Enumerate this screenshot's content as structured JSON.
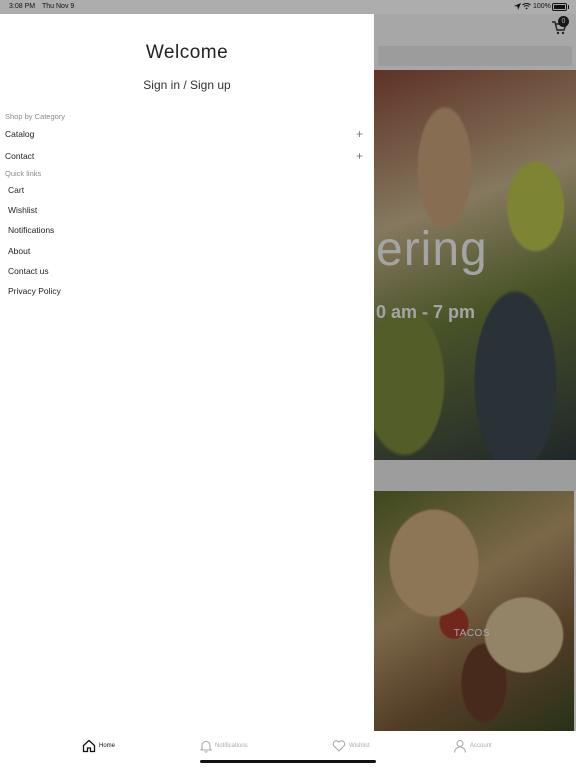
{
  "status_bar": {
    "time": "3:08 PM",
    "date": "Thu Nov 9",
    "battery": "100%"
  },
  "background": {
    "cart_count": "0",
    "hero_text": "ering",
    "hero_hours": "0 am - 7 pm",
    "product_label": "TACOS"
  },
  "drawer": {
    "title": "Welcome",
    "auth_link": "Sign in / Sign up",
    "shop_section": "Shop by Category",
    "categories": [
      {
        "label": "Catalog"
      },
      {
        "label": "Contact"
      }
    ],
    "quick_section": "Quick links",
    "quick_links": [
      {
        "label": "Cart"
      },
      {
        "label": "Wishlist"
      },
      {
        "label": "Notifications"
      },
      {
        "label": "About"
      },
      {
        "label": "Contact us"
      },
      {
        "label": "Privacy Policy"
      }
    ]
  },
  "tabbar": {
    "tabs": [
      {
        "label": "Home",
        "icon": "home-icon"
      },
      {
        "label": "Notifications",
        "icon": "bell-icon"
      },
      {
        "label": "Wishlist",
        "icon": "heart-icon"
      },
      {
        "label": "Account",
        "icon": "person-icon"
      }
    ]
  }
}
